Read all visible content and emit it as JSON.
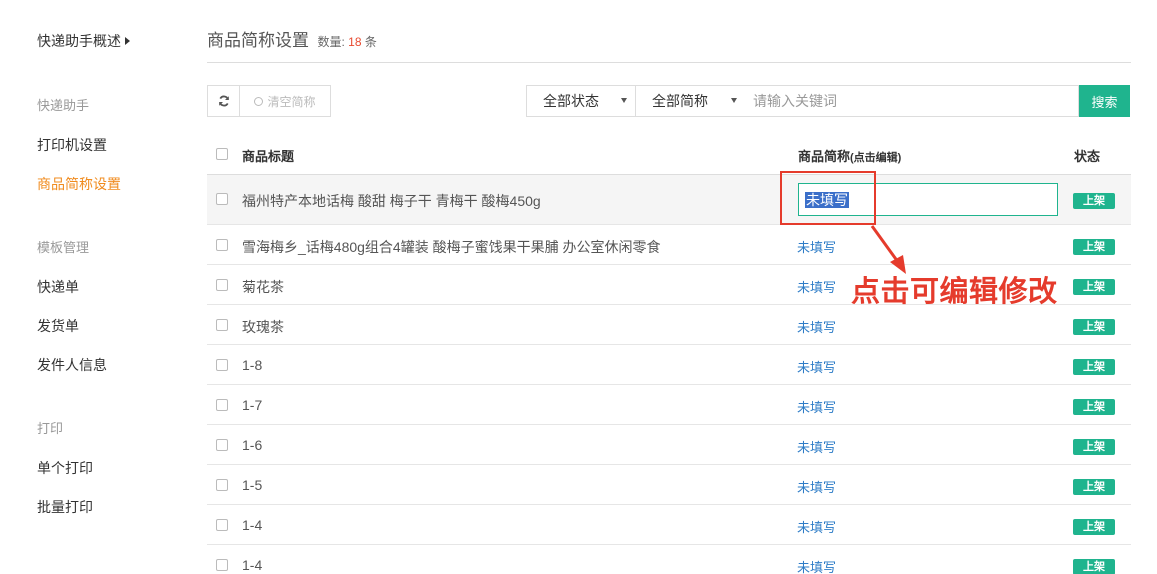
{
  "sidebar": {
    "top_link": "快递助手概述",
    "groups": [
      {
        "label": "快递助手",
        "items": [
          "打印机设置",
          "商品简称设置"
        ]
      },
      {
        "label": "模板管理",
        "items": [
          "快递单",
          "发货单",
          "发件人信息"
        ]
      },
      {
        "label": "打印",
        "items": [
          "单个打印",
          "批量打印"
        ]
      }
    ],
    "active_item": "商品简称设置"
  },
  "header": {
    "title": "商品简称设置",
    "count_label": "数量:",
    "count_value": "18",
    "count_unit": "条"
  },
  "toolbar": {
    "refresh_icon": "refresh-icon",
    "clear_label": "清空简称",
    "status_select": "全部状态",
    "alias_select": "全部简称",
    "search_placeholder": "请输入关键词",
    "search_label": "搜索"
  },
  "table": {
    "columns": {
      "title": "商品标题",
      "alias": "商品简称",
      "alias_hint": "(点击编辑)",
      "status": "状态"
    },
    "rows": [
      {
        "title": "福州特产本地话梅 酸甜 梅子干 青梅干 酸梅450g",
        "alias": "未填写",
        "status": "上架",
        "editing": true
      },
      {
        "title": "雪海梅乡_话梅480g组合4罐装 酸梅子蜜饯果干果脯 办公室休闲零食",
        "alias": "未填写",
        "status": "上架"
      },
      {
        "title": "菊花茶",
        "alias": "未填写",
        "status": "上架"
      },
      {
        "title": "玫瑰茶",
        "alias": "未填写",
        "status": "上架"
      },
      {
        "title": "1-8",
        "alias": "未填写",
        "status": "上架"
      },
      {
        "title": "1-7",
        "alias": "未填写",
        "status": "上架"
      },
      {
        "title": "1-6",
        "alias": "未填写",
        "status": "上架"
      },
      {
        "title": "1-5",
        "alias": "未填写",
        "status": "上架"
      },
      {
        "title": "1-4",
        "alias": "未填写",
        "status": "上架"
      },
      {
        "title": "1-4",
        "alias": "未填写",
        "status": "上架"
      }
    ]
  },
  "annotation": {
    "text": "点击可编辑修改"
  },
  "colors": {
    "accent": "#1fb48e",
    "active_nav": "#f08b1e",
    "link": "#2d7cc7",
    "annotation": "#e53b2c",
    "count": "#e8492f"
  }
}
